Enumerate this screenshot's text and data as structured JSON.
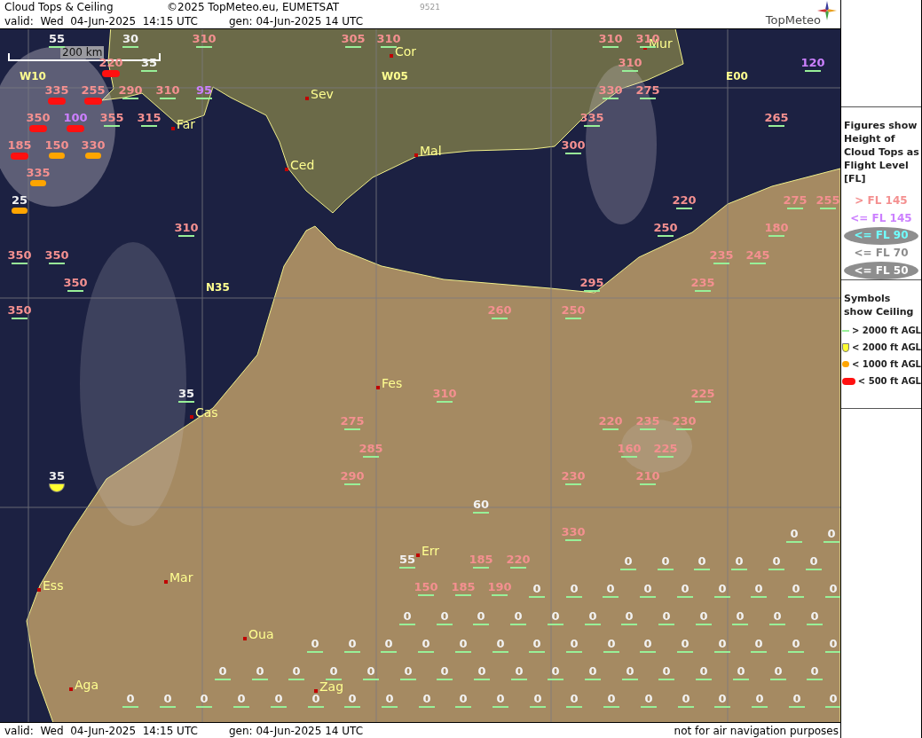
{
  "header": {
    "title": "Cloud Tops & Ceiling",
    "copyright": "©2025 TopMeteo.eu, EUMETSAT",
    "code": "9521",
    "valid": "valid:  Wed  04-Jun-2025  14:15 UTC",
    "generated": "gen: 04-Jun-2025 14 UTC",
    "logo": "TopMeteo"
  },
  "map": {
    "scale": "200 km",
    "grid_labels": [
      "W10",
      "W05",
      "E00",
      "N35"
    ],
    "cities": [
      "Cor",
      "Mur",
      "Sev",
      "Far",
      "Ced",
      "Mal",
      "Fes",
      "Cas",
      "Err",
      "Ess",
      "Mar",
      "Oua",
      "Aga",
      "Zag"
    ],
    "figures": [
      {
        "value": "55",
        "color": "#f2f2f2",
        "kind": "above2000"
      },
      {
        "value": "30",
        "color": "#f2f2f2",
        "kind": "above2000"
      },
      {
        "value": "310",
        "color": "#f49090",
        "kind": "above2000"
      },
      {
        "value": "305",
        "color": "#f49090",
        "kind": "above2000"
      },
      {
        "value": "310",
        "color": "#f49090",
        "kind": "above2000"
      },
      {
        "value": "310",
        "color": "#f49090",
        "kind": "above2000"
      },
      {
        "value": "310",
        "color": "#f49090",
        "kind": "above2000"
      },
      {
        "value": "220",
        "color": "#f49090",
        "kind": "below500"
      },
      {
        "value": "35",
        "color": "#f2f2f2",
        "kind": "above2000"
      },
      {
        "value": "310",
        "color": "#f49090",
        "kind": "above2000"
      },
      {
        "value": "120",
        "color": "#cc80ff",
        "kind": "above2000"
      },
      {
        "value": "335",
        "color": "#f49090",
        "kind": "below500"
      },
      {
        "value": "255",
        "color": "#f49090",
        "kind": "below500"
      },
      {
        "value": "290",
        "color": "#f49090",
        "kind": "above2000"
      },
      {
        "value": "310",
        "color": "#f49090",
        "kind": "above2000"
      },
      {
        "value": "95",
        "color": "#cc80ff",
        "kind": "above2000"
      },
      {
        "value": "330",
        "color": "#f49090",
        "kind": "above2000"
      },
      {
        "value": "275",
        "color": "#f49090",
        "kind": "above2000"
      },
      {
        "value": "350",
        "color": "#f49090",
        "kind": "below500"
      },
      {
        "value": "100",
        "color": "#cc80ff",
        "kind": "below500"
      },
      {
        "value": "355",
        "color": "#f49090",
        "kind": "above2000"
      },
      {
        "value": "315",
        "color": "#f49090",
        "kind": "above2000"
      },
      {
        "value": "335",
        "color": "#f49090",
        "kind": "above2000"
      },
      {
        "value": "265",
        "color": "#f49090",
        "kind": "above2000"
      },
      {
        "value": "185",
        "color": "#f49090",
        "kind": "below500"
      },
      {
        "value": "150",
        "color": "#f49090",
        "kind": "below1000"
      },
      {
        "value": "330",
        "color": "#f49090",
        "kind": "below1000"
      },
      {
        "value": "300",
        "color": "#f49090",
        "kind": "above2000"
      },
      {
        "value": "335",
        "color": "#f49090",
        "kind": "below1000"
      },
      {
        "value": "25",
        "color": "#f2f2f2",
        "kind": "below1000"
      },
      {
        "value": "220",
        "color": "#f49090",
        "kind": "above2000"
      },
      {
        "value": "275",
        "color": "#f49090",
        "kind": "above2000"
      },
      {
        "value": "255",
        "color": "#f49090",
        "kind": "above2000"
      },
      {
        "value": "310",
        "color": "#f49090",
        "kind": "above2000"
      },
      {
        "value": "250",
        "color": "#f49090",
        "kind": "above2000"
      },
      {
        "value": "180",
        "color": "#f49090",
        "kind": "above2000"
      },
      {
        "value": "350",
        "color": "#f49090",
        "kind": "above2000"
      },
      {
        "value": "350",
        "color": "#f49090",
        "kind": "above2000"
      },
      {
        "value": "235",
        "color": "#f49090",
        "kind": "above2000"
      },
      {
        "value": "245",
        "color": "#f49090",
        "kind": "above2000"
      },
      {
        "value": "350",
        "color": "#f49090",
        "kind": "above2000"
      },
      {
        "value": "295",
        "color": "#f49090",
        "kind": "above2000"
      },
      {
        "value": "235",
        "color": "#f49090",
        "kind": "above2000"
      },
      {
        "value": "350",
        "color": "#f49090",
        "kind": "above2000"
      },
      {
        "value": "260",
        "color": "#f49090",
        "kind": "above2000"
      },
      {
        "value": "250",
        "color": "#f49090",
        "kind": "above2000"
      },
      {
        "value": "35",
        "color": "#f2f2f2",
        "kind": "above2000"
      },
      {
        "value": "310",
        "color": "#f49090",
        "kind": "above2000"
      },
      {
        "value": "225",
        "color": "#f49090",
        "kind": "above2000"
      },
      {
        "value": "275",
        "color": "#f49090",
        "kind": "above2000"
      },
      {
        "value": "220",
        "color": "#f49090",
        "kind": "above2000"
      },
      {
        "value": "235",
        "color": "#f49090",
        "kind": "above2000"
      },
      {
        "value": "230",
        "color": "#f49090",
        "kind": "above2000"
      },
      {
        "value": "285",
        "color": "#f49090",
        "kind": "above2000"
      },
      {
        "value": "160",
        "color": "#f49090",
        "kind": "above2000"
      },
      {
        "value": "225",
        "color": "#f49090",
        "kind": "above2000"
      },
      {
        "value": "35",
        "color": "#f2f2f2",
        "kind": "below2000"
      },
      {
        "value": "290",
        "color": "#f49090",
        "kind": "above2000"
      },
      {
        "value": "230",
        "color": "#f49090",
        "kind": "above2000"
      },
      {
        "value": "210",
        "color": "#f49090",
        "kind": "above2000"
      },
      {
        "value": "60",
        "color": "#f2f2f2",
        "kind": "above2000"
      },
      {
        "value": "330",
        "color": "#f49090",
        "kind": "above2000"
      },
      {
        "value": "55",
        "color": "#f2f2f2",
        "kind": "above2000"
      },
      {
        "value": "185",
        "color": "#f49090",
        "kind": "above2000"
      },
      {
        "value": "220",
        "color": "#f49090",
        "kind": "above2000"
      },
      {
        "value": "150",
        "color": "#f49090",
        "kind": "above2000"
      },
      {
        "value": "185",
        "color": "#f49090",
        "kind": "above2000"
      },
      {
        "value": "190",
        "color": "#f49090",
        "kind": "above2000"
      }
    ],
    "figure_rows": [
      {
        "figures": [
          {
            "value": "0",
            "color": "#f2f2f2",
            "kind": "above2000"
          },
          {
            "value": "0",
            "color": "#f2f2f2",
            "kind": "above2000"
          }
        ]
      },
      {
        "figures": [
          {
            "value": "0",
            "color": "#f2f2f2",
            "kind": "above2000"
          },
          {
            "value": "0",
            "color": "#f2f2f2",
            "kind": "above2000"
          },
          {
            "value": "0",
            "color": "#f2f2f2",
            "kind": "above2000"
          },
          {
            "value": "0",
            "color": "#f2f2f2",
            "kind": "above2000"
          },
          {
            "value": "0",
            "color": "#f2f2f2",
            "kind": "above2000"
          },
          {
            "value": "0",
            "color": "#f2f2f2",
            "kind": "above2000"
          }
        ]
      },
      {
        "figures": [
          {
            "value": "0",
            "color": "#f2f2f2",
            "kind": "above2000"
          },
          {
            "value": "0",
            "color": "#f2f2f2",
            "kind": "above2000"
          },
          {
            "value": "0",
            "color": "#f2f2f2",
            "kind": "above2000"
          },
          {
            "value": "0",
            "color": "#f2f2f2",
            "kind": "above2000"
          },
          {
            "value": "0",
            "color": "#f2f2f2",
            "kind": "above2000"
          },
          {
            "value": "0",
            "color": "#f2f2f2",
            "kind": "above2000"
          },
          {
            "value": "0",
            "color": "#f2f2f2",
            "kind": "above2000"
          },
          {
            "value": "0",
            "color": "#f2f2f2",
            "kind": "above2000"
          },
          {
            "value": "0",
            "color": "#f2f2f2",
            "kind": "above2000"
          }
        ]
      },
      {
        "figures": [
          {
            "value": "0",
            "color": "#f2f2f2",
            "kind": "above2000"
          },
          {
            "value": "0",
            "color": "#f2f2f2",
            "kind": "above2000"
          },
          {
            "value": "0",
            "color": "#f2f2f2",
            "kind": "above2000"
          },
          {
            "value": "0",
            "color": "#f2f2f2",
            "kind": "above2000"
          },
          {
            "value": "0",
            "color": "#f2f2f2",
            "kind": "above2000"
          },
          {
            "value": "0",
            "color": "#f2f2f2",
            "kind": "above2000"
          },
          {
            "value": "0",
            "color": "#f2f2f2",
            "kind": "above2000"
          },
          {
            "value": "0",
            "color": "#f2f2f2",
            "kind": "above2000"
          },
          {
            "value": "0",
            "color": "#f2f2f2",
            "kind": "above2000"
          },
          {
            "value": "0",
            "color": "#f2f2f2",
            "kind": "above2000"
          },
          {
            "value": "0",
            "color": "#f2f2f2",
            "kind": "above2000"
          },
          {
            "value": "0",
            "color": "#f2f2f2",
            "kind": "above2000"
          }
        ]
      },
      {
        "figures": [
          {
            "value": "0",
            "color": "#f2f2f2",
            "kind": "above2000"
          },
          {
            "value": "0",
            "color": "#f2f2f2",
            "kind": "above2000"
          },
          {
            "value": "0",
            "color": "#f2f2f2",
            "kind": "above2000"
          },
          {
            "value": "0",
            "color": "#f2f2f2",
            "kind": "above2000"
          },
          {
            "value": "0",
            "color": "#f2f2f2",
            "kind": "above2000"
          },
          {
            "value": "0",
            "color": "#f2f2f2",
            "kind": "above2000"
          },
          {
            "value": "0",
            "color": "#f2f2f2",
            "kind": "above2000"
          },
          {
            "value": "0",
            "color": "#f2f2f2",
            "kind": "above2000"
          },
          {
            "value": "0",
            "color": "#f2f2f2",
            "kind": "above2000"
          },
          {
            "value": "0",
            "color": "#f2f2f2",
            "kind": "above2000"
          },
          {
            "value": "0",
            "color": "#f2f2f2",
            "kind": "above2000"
          },
          {
            "value": "0",
            "color": "#f2f2f2",
            "kind": "above2000"
          },
          {
            "value": "0",
            "color": "#f2f2f2",
            "kind": "above2000"
          },
          {
            "value": "0",
            "color": "#f2f2f2",
            "kind": "above2000"
          },
          {
            "value": "0",
            "color": "#f2f2f2",
            "kind": "above2000"
          }
        ]
      },
      {
        "figures": [
          {
            "value": "0",
            "color": "#f2f2f2",
            "kind": "above2000"
          },
          {
            "value": "0",
            "color": "#f2f2f2",
            "kind": "above2000"
          },
          {
            "value": "0",
            "color": "#f2f2f2",
            "kind": "above2000"
          },
          {
            "value": "0",
            "color": "#f2f2f2",
            "kind": "above2000"
          },
          {
            "value": "0",
            "color": "#f2f2f2",
            "kind": "above2000"
          },
          {
            "value": "0",
            "color": "#f2f2f2",
            "kind": "above2000"
          },
          {
            "value": "0",
            "color": "#f2f2f2",
            "kind": "above2000"
          },
          {
            "value": "0",
            "color": "#f2f2f2",
            "kind": "above2000"
          },
          {
            "value": "0",
            "color": "#f2f2f2",
            "kind": "above2000"
          },
          {
            "value": "0",
            "color": "#f2f2f2",
            "kind": "above2000"
          },
          {
            "value": "0",
            "color": "#f2f2f2",
            "kind": "above2000"
          },
          {
            "value": "0",
            "color": "#f2f2f2",
            "kind": "above2000"
          },
          {
            "value": "0",
            "color": "#f2f2f2",
            "kind": "above2000"
          },
          {
            "value": "0",
            "color": "#f2f2f2",
            "kind": "above2000"
          },
          {
            "value": "0",
            "color": "#f2f2f2",
            "kind": "above2000"
          },
          {
            "value": "0",
            "color": "#f2f2f2",
            "kind": "above2000"
          },
          {
            "value": "0",
            "color": "#f2f2f2",
            "kind": "above2000"
          }
        ]
      },
      {
        "figures": [
          {
            "value": "0",
            "color": "#f2f2f2",
            "kind": "above2000"
          },
          {
            "value": "0",
            "color": "#f2f2f2",
            "kind": "above2000"
          },
          {
            "value": "0",
            "color": "#f2f2f2",
            "kind": "above2000"
          },
          {
            "value": "0",
            "color": "#f2f2f2",
            "kind": "above2000"
          },
          {
            "value": "0",
            "color": "#f2f2f2",
            "kind": "above2000"
          },
          {
            "value": "0",
            "color": "#f2f2f2",
            "kind": "above2000"
          },
          {
            "value": "0",
            "color": "#f2f2f2",
            "kind": "above2000"
          },
          {
            "value": "0",
            "color": "#f2f2f2",
            "kind": "above2000"
          },
          {
            "value": "0",
            "color": "#f2f2f2",
            "kind": "above2000"
          },
          {
            "value": "0",
            "color": "#f2f2f2",
            "kind": "above2000"
          },
          {
            "value": "0",
            "color": "#f2f2f2",
            "kind": "above2000"
          },
          {
            "value": "0",
            "color": "#f2f2f2",
            "kind": "above2000"
          },
          {
            "value": "0",
            "color": "#f2f2f2",
            "kind": "above2000"
          },
          {
            "value": "0",
            "color": "#f2f2f2",
            "kind": "above2000"
          },
          {
            "value": "0",
            "color": "#f2f2f2",
            "kind": "above2000"
          },
          {
            "value": "0",
            "color": "#f2f2f2",
            "kind": "above2000"
          },
          {
            "value": "0",
            "color": "#f2f2f2",
            "kind": "above2000"
          },
          {
            "value": "0",
            "color": "#f2f2f2",
            "kind": "above2000"
          },
          {
            "value": "0",
            "color": "#f2f2f2",
            "kind": "above2000"
          },
          {
            "value": "0",
            "color": "#f2f2f2",
            "kind": "above2000"
          }
        ]
      }
    ]
  },
  "legend": {
    "tops_heading": "Figures show Height of Cloud Tops as Flight Level  [FL]",
    "tops_items": [
      {
        "label": "> FL 145",
        "color": "#f49090",
        "oval": false
      },
      {
        "label": "<= FL 145",
        "color": "#cc80ff",
        "oval": false
      },
      {
        "label": "<= FL 90",
        "color": "#70ffff",
        "oval": true
      },
      {
        "label": "<= FL 70",
        "color": "#8c8c8c",
        "oval": false
      },
      {
        "label": "<= FL 50",
        "color": "#ffffff",
        "oval": true
      }
    ],
    "ceiling_heading": "Symbols show Ceiling",
    "ceiling_items": [
      {
        "label": "> 2000 ft AGL",
        "kind": "above2000"
      },
      {
        "label": "< 2000 ft AGL",
        "kind": "below2000"
      },
      {
        "label": "< 1000 ft AGL",
        "kind": "below1000"
      },
      {
        "label": "< 500 ft AGL",
        "kind": "below500"
      }
    ]
  },
  "footer": {
    "valid": "valid:  Wed  04-Jun-2025  14:15 UTC",
    "generated": "gen: 04-Jun-2025 14 UTC",
    "disclaimer": "not for air navigation purposes"
  }
}
